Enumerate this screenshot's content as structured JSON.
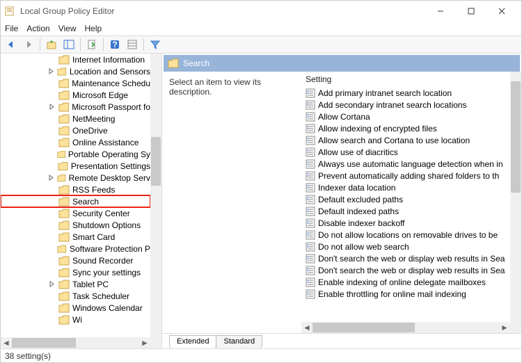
{
  "title": "Local Group Policy Editor",
  "menu": {
    "file": "File",
    "action": "Action",
    "view": "View",
    "help": "Help"
  },
  "tree": {
    "items": [
      {
        "label": "Internet Information",
        "exp": false
      },
      {
        "label": "Location and Sensors",
        "exp": true
      },
      {
        "label": "Maintenance Schedu",
        "exp": false
      },
      {
        "label": "Microsoft Edge",
        "exp": false
      },
      {
        "label": "Microsoft Passport fo",
        "exp": true
      },
      {
        "label": "NetMeeting",
        "exp": false
      },
      {
        "label": "OneDrive",
        "exp": false
      },
      {
        "label": "Online Assistance",
        "exp": false
      },
      {
        "label": "Portable Operating Sy",
        "exp": false
      },
      {
        "label": "Presentation Settings",
        "exp": false
      },
      {
        "label": "Remote Desktop Serv",
        "exp": true
      },
      {
        "label": "RSS Feeds",
        "exp": false
      },
      {
        "label": "Search",
        "exp": false,
        "highlight": true
      },
      {
        "label": "Security Center",
        "exp": false
      },
      {
        "label": "Shutdown Options",
        "exp": false
      },
      {
        "label": "Smart Card",
        "exp": false
      },
      {
        "label": "Software Protection P",
        "exp": false
      },
      {
        "label": "Sound Recorder",
        "exp": false
      },
      {
        "label": "Sync your settings",
        "exp": false
      },
      {
        "label": "Tablet PC",
        "exp": true
      },
      {
        "label": "Task Scheduler",
        "exp": false
      },
      {
        "label": "Windows Calendar",
        "exp": false
      },
      {
        "label": "Wi",
        "exp": false
      }
    ]
  },
  "right": {
    "header": "Search",
    "description": "Select an item to view its description.",
    "column": "Setting",
    "settings": [
      "Add primary intranet search location",
      "Add secondary intranet search locations",
      "Allow Cortana",
      "Allow indexing of encrypted files",
      "Allow search and Cortana to use location",
      "Allow use of diacritics",
      "Always use automatic language detection when in",
      "Prevent automatically adding shared folders to th",
      "Indexer data location",
      "Default excluded paths",
      "Default indexed paths",
      "Disable indexer backoff",
      "Do not allow locations on removable drives to be",
      "Do not allow web search",
      "Don't search the web or display web results in Sea",
      "Don't search the web or display web results in Sea",
      "Enable indexing of online delegate mailboxes",
      "Enable throttling for online mail indexing"
    ]
  },
  "tabs": {
    "extended": "Extended",
    "standard": "Standard"
  },
  "status": "38 setting(s)"
}
